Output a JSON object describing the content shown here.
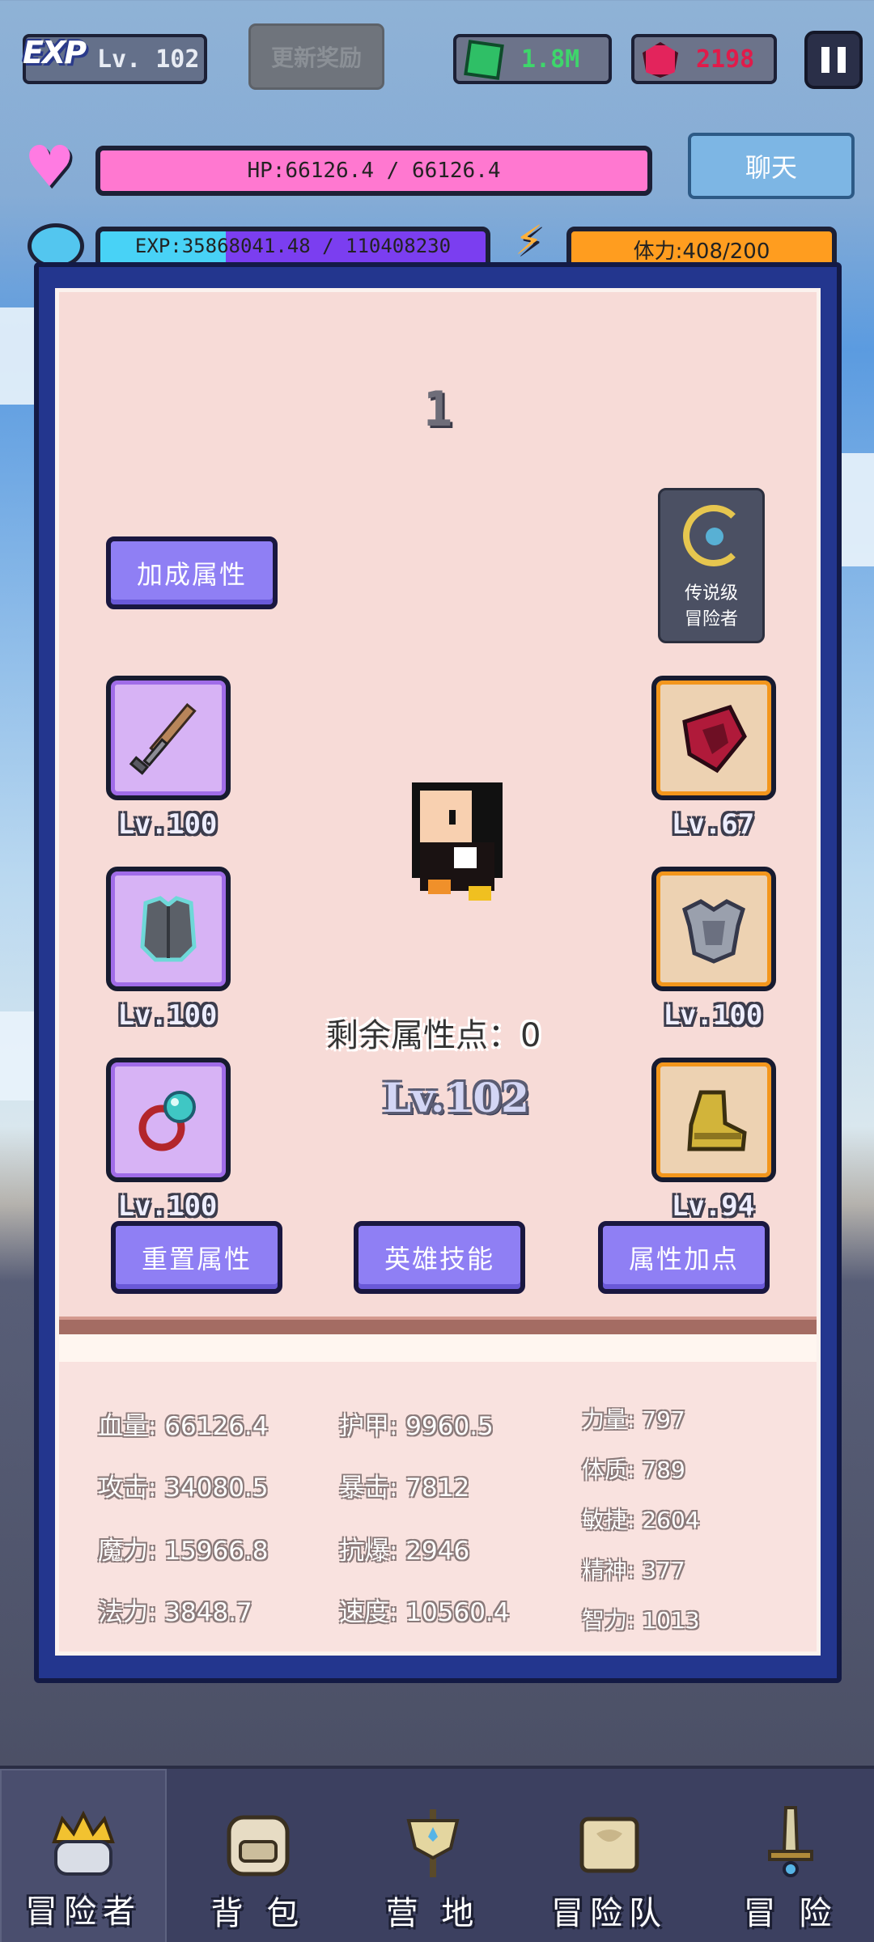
{
  "hud": {
    "exp_logo": "EXP",
    "level": "Lv. 102",
    "reward_button": "更新奖励",
    "gems": "1.8M",
    "rubies": "2198",
    "hp_text": "HP:66126.4 / 66126.4",
    "chat_button": "聊天",
    "exp_text": "EXP:35868041.48 / 110408230",
    "exp_progress": 0.325,
    "stamina_text": "体力:408/200",
    "colors": {
      "hp": "#ff78d0",
      "exp": "#7b3ef0",
      "stamina": "#ff9d1f"
    }
  },
  "panel": {
    "top_number": "1",
    "bonus_button": "加成属性",
    "badge_line1": "传说级",
    "badge_line2": "冒险者",
    "left_slots": [
      {
        "icon": "sword-icon",
        "level": "Lv.100"
      },
      {
        "icon": "chest-armor-icon",
        "level": "Lv.100"
      },
      {
        "icon": "ring-icon",
        "level": "Lv.100"
      }
    ],
    "right_slots": [
      {
        "icon": "shield-icon",
        "level": "Lv.67"
      },
      {
        "icon": "plate-armor-icon",
        "level": "Lv.100"
      },
      {
        "icon": "boots-icon",
        "level": "Lv.94"
      }
    ],
    "remaining_points": "剩余属性点：0",
    "hero_level": "Lv.102",
    "buttons": [
      "重置属性",
      "英雄技能",
      "属性加点"
    ]
  },
  "stats": {
    "col1": [
      "血量: 66126.4",
      "攻击: 34080.5",
      "魔力: 15966.8",
      "法力: 3848.7"
    ],
    "col2": [
      "护甲: 9960.5",
      "暴击: 7812",
      "抗爆: 2946",
      "速度: 10560.4"
    ],
    "col3": [
      "力量: 797",
      "体质: 789",
      "敏捷: 2604",
      "精神: 377",
      "智力: 1013"
    ]
  },
  "nav": [
    {
      "label": "冒险者",
      "icon": "crown-helmet-icon"
    },
    {
      "label": "背 包",
      "icon": "backpack-icon"
    },
    {
      "label": "营 地",
      "icon": "camp-banner-icon"
    },
    {
      "label": "冒险队",
      "icon": "book-icon"
    },
    {
      "label": "冒 险",
      "icon": "sword-hilt-icon"
    }
  ]
}
